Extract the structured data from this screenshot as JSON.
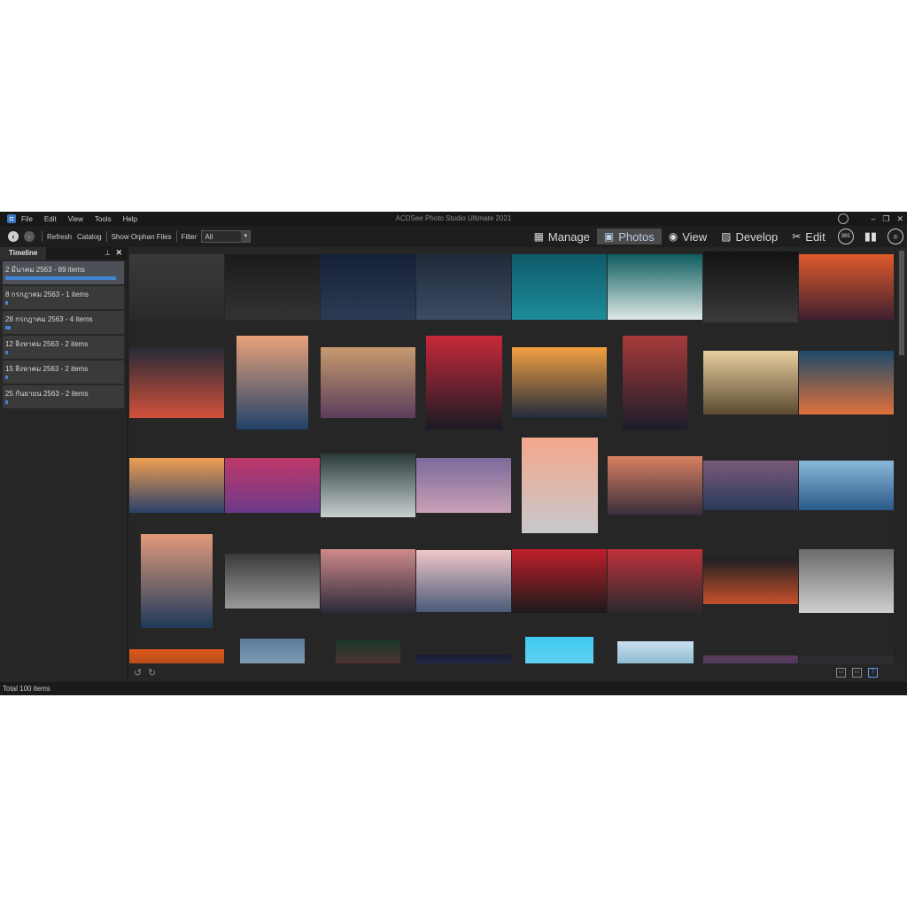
{
  "menubar": {
    "items": [
      "File",
      "Edit",
      "View",
      "Tools",
      "Help"
    ],
    "window_title": "ACDSee Photo Studio Ultimate 2021"
  },
  "toolbar": {
    "refresh": "Refresh",
    "catalog": "Catalog",
    "show_orphan": "Show Orphan Files",
    "filter_label": "Filter",
    "filter_value": "All"
  },
  "modes": [
    {
      "label": "Manage",
      "icon": "grid-icon",
      "active": false
    },
    {
      "label": "Photos",
      "icon": "photos-icon",
      "active": true
    },
    {
      "label": "View",
      "icon": "eye-icon",
      "active": false
    },
    {
      "label": "Develop",
      "icon": "develop-icon",
      "active": false
    },
    {
      "label": "Edit",
      "icon": "edit-icon",
      "active": false
    }
  ],
  "extra_icons": {
    "badge_365": "365"
  },
  "panel": {
    "tab": "Timeline",
    "items": [
      {
        "label": "2 มีนาคม 2563 - 89 items",
        "fraction": 0.89,
        "selected": true
      },
      {
        "label": "8 กรกฎาคม 2563 - 1 items",
        "fraction": 0.01,
        "selected": false
      },
      {
        "label": "28 กรกฎาคม 2563 - 4 items",
        "fraction": 0.04,
        "selected": false
      },
      {
        "label": "12 สิงหาคม 2563 - 2 items",
        "fraction": 0.02,
        "selected": false
      },
      {
        "label": "15 สิงหาคม 2563 - 2 items",
        "fraction": 0.02,
        "selected": false
      },
      {
        "label": "25 กันยายน 2563 - 2 items",
        "fraction": 0.02,
        "selected": false
      }
    ]
  },
  "photo_colors": [
    [
      "#3a3a3a",
      "#2a2a2a"
    ],
    [
      "#1b1b1b",
      "#333"
    ],
    [
      "#142036",
      "#2d3c55"
    ],
    [
      "#1f2a3a",
      "#3d4b63"
    ],
    [
      "#0f5a6a",
      "#1e8c99"
    ],
    [
      "#0d5b5e",
      "#dde8e6"
    ],
    [
      "#121212",
      "#3b3b3b"
    ],
    [
      "#e05a2c",
      "#402030"
    ],
    [
      "#262a36",
      "#d2503a"
    ],
    [
      "#e9a27a",
      "#22426a"
    ],
    [
      "#c79a6e",
      "#5a3d5d"
    ],
    [
      "#c8283a",
      "#1a1a24"
    ],
    [
      "#f2a040",
      "#232c3c"
    ],
    [
      "#a83a3a",
      "#1c1c2a"
    ],
    [
      "#e8cfa0",
      "#5a4a30"
    ],
    [
      "#1d4a6a",
      "#e0703a"
    ],
    [
      "#f0a050",
      "#2a3f6a"
    ],
    [
      "#c0386a",
      "#6a3a8a"
    ],
    [
      "#2a3a3a",
      "#c8d0d0"
    ],
    [
      "#7a6a9a",
      "#c9a0b6"
    ],
    [
      "#f4a78c",
      "#c8c8cc"
    ],
    [
      "#d88060",
      "#3a2e3c"
    ],
    [
      "#7a5a7a",
      "#2a3a5a"
    ],
    [
      "#8ab8d8",
      "#2a5a8a"
    ],
    [
      "#e29a7a",
      "#1e3a5a"
    ],
    [
      "#3a3a3a",
      "#9a9a9a"
    ],
    [
      "#d08a8a",
      "#2a2a3a"
    ],
    [
      "#f0c8c8",
      "#4a5a7a"
    ],
    [
      "#c01f2a",
      "#1a1a1a"
    ],
    [
      "#c0303a",
      "#2a2a2e"
    ],
    [
      "#1f1f24",
      "#c8502a"
    ],
    [
      "#6a6a6a",
      "#cfcfcf"
    ],
    [
      "#e05a1a",
      "#3a2020"
    ],
    [
      "#5a7a9a",
      "#c8dce8"
    ],
    [
      "#1a3a2a",
      "#c0203a"
    ],
    [
      "#1a1a30",
      "#2a6aa0"
    ],
    [
      "#40c8f0",
      "#a0e8f8"
    ],
    [
      "#c8e0f0",
      "#1a6a8a"
    ],
    [
      "#5a3a5a",
      "#2a3a6a"
    ],
    [
      "#2a2a2a",
      "#4a4060"
    ]
  ]
}
